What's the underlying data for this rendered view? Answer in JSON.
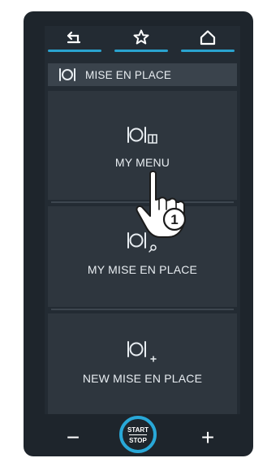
{
  "nav": {
    "back_icon": "back-arrow-icon",
    "favorites_icon": "star-icon",
    "home_icon": "home-icon",
    "accent_color": "#2aa3cf"
  },
  "header": {
    "icon": "place-setting-icon",
    "title": "MISE EN PLACE"
  },
  "tiles": [
    {
      "label": "MY MENU",
      "icon": "place-setting-book-icon"
    },
    {
      "label": "MY MISE EN PLACE",
      "icon": "place-setting-search-icon"
    },
    {
      "label": "NEW MISE EN PLACE",
      "icon": "place-setting-plus-icon"
    }
  ],
  "callout": {
    "step": "1",
    "icon": "pointing-hand-icon"
  },
  "controls": {
    "minus": "−",
    "plus": "+",
    "start_label": "START",
    "stop_label": "STOP",
    "ring_color": "#29a8d8"
  }
}
